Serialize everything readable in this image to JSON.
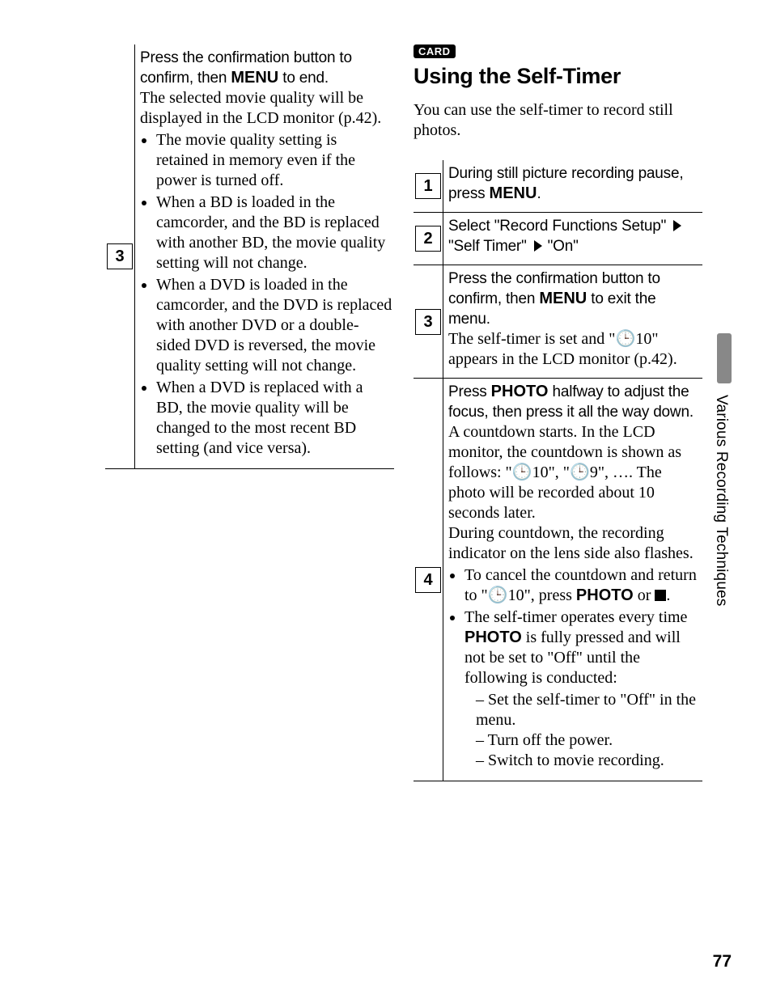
{
  "left": {
    "step3": {
      "num": "3",
      "head_a": "Press the confirmation button to confirm, then ",
      "head_menu": "MENU",
      "head_b": " to end.",
      "detail": "The selected movie quality will be displayed in the LCD monitor (p.42).",
      "b1": "The movie quality setting is retained in memory even if the power is turned off.",
      "b2": "When a BD is loaded in the camcorder, and the BD is replaced with another BD, the movie quality setting will not change.",
      "b3": "When a DVD is loaded in the camcorder, and the DVD is replaced with another DVD or a double-sided DVD is reversed, the movie quality setting will not change.",
      "b4": "When a DVD is replaced with a BD, the movie quality will be changed to the most recent BD setting (and vice versa)."
    }
  },
  "right": {
    "badge": "CARD",
    "title": "Using the Self-Timer",
    "intro": "You can use the self-timer to record still photos.",
    "s1": {
      "num": "1",
      "a": "During still picture recording pause, press ",
      "menu": "MENU",
      "b": "."
    },
    "s2": {
      "num": "2",
      "a": "Select ",
      "q1": "\"Record Functions Setup\"",
      "q2": "\"Self Timer\"",
      "q3": "\"On\""
    },
    "s3": {
      "num": "3",
      "a": "Press the confirmation button to confirm, then ",
      "menu": "MENU",
      "b": " to exit the menu.",
      "detail_a": "The self-timer is set and \"",
      "detail_b": "10\" appears in the LCD monitor (p.42)."
    },
    "s4": {
      "num": "4",
      "head_a": "Press ",
      "photo": "PHOTO",
      "head_b": " halfway to adjust the focus, then press it all the way down.",
      "p_a": "A countdown starts. In the LCD monitor, the countdown is shown as follows: \"",
      "p_b": "10\", \"",
      "p_c": "9\", …. The photo will be recorded about 10 seconds later.",
      "p_d": "During countdown, the recording indicator on the lens side also flashes.",
      "bul1_a": "To cancel the countdown and return to \"",
      "bul1_b": "10\", press ",
      "bul1_photo": "PHOTO",
      "bul1_c": " or ",
      "bul1_d": ".",
      "bul2_a": "The self-timer operates every time ",
      "bul2_photo": "PHOTO",
      "bul2_b": " is fully pressed and will not be set to \"Off\" until the following is conducted:",
      "d1": "Set the self-timer to \"Off\" in the menu.",
      "d2": "Turn off the power.",
      "d3": "Switch to movie recording."
    }
  },
  "sidetab": "Various Recording Techniques",
  "pagenum": "77"
}
